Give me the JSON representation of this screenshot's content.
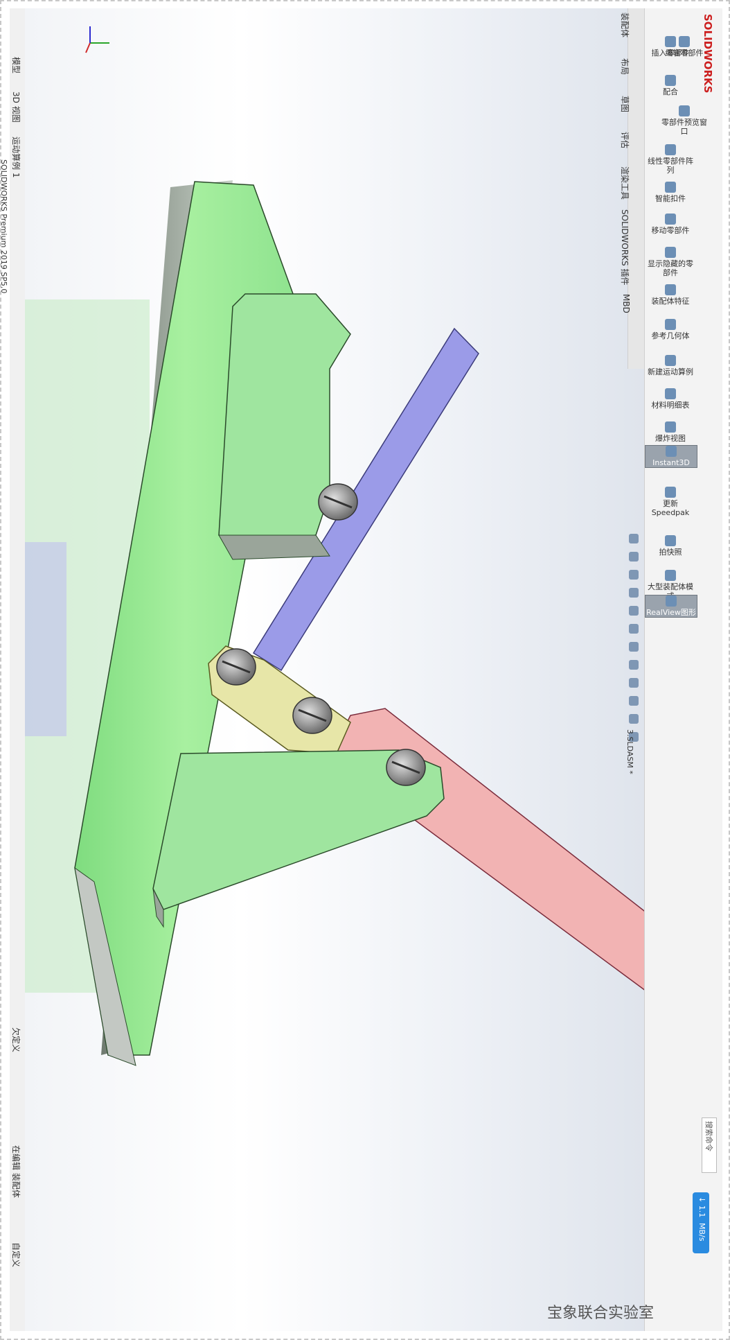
{
  "app": {
    "brand": "SOLIDWORKS",
    "document_title": "3.SLDASM *",
    "status_product": "SOLIDWORKS Premium 2019 SP5.0",
    "search_placeholder": "搜索命令"
  },
  "ribbon": {
    "tools": [
      {
        "label": "编辑零部件",
        "icon": "edit-component-icon"
      },
      {
        "label": "插入零部件",
        "icon": "insert-component-icon"
      },
      {
        "label": "配合",
        "icon": "mate-icon"
      },
      {
        "label": "零部件预览窗口",
        "icon": "component-preview-icon"
      },
      {
        "label": "线性零部件阵列",
        "icon": "linear-pattern-icon"
      },
      {
        "label": "智能扣件",
        "icon": "smart-fastener-icon"
      },
      {
        "label": "移动零部件",
        "icon": "move-component-icon"
      },
      {
        "label": "显示隐藏的零部件",
        "icon": "show-hidden-icon"
      },
      {
        "label": "装配体特征",
        "icon": "assembly-feature-icon"
      },
      {
        "label": "参考几何体",
        "icon": "reference-geometry-icon"
      },
      {
        "label": "新建运动算例",
        "icon": "motion-study-icon"
      },
      {
        "label": "材料明细表",
        "icon": "bom-icon"
      },
      {
        "label": "爆炸视图",
        "icon": "exploded-view-icon"
      },
      {
        "label": "Instant3D",
        "icon": "instant3d-icon",
        "active": true
      },
      {
        "label": "更新Speedpak",
        "icon": "speedpak-icon"
      },
      {
        "label": "拍快照",
        "icon": "snapshot-icon"
      },
      {
        "label": "大型装配体模式",
        "icon": "large-assembly-icon"
      },
      {
        "label": "RealView图形",
        "icon": "realview-icon",
        "active": true
      }
    ],
    "tabs": [
      "装配体",
      "布局",
      "草图",
      "评估",
      "渲染工具",
      "SOLIDWORKS 插件",
      "MBD"
    ]
  },
  "bottom_tabs": [
    "模型",
    "3D 视图",
    "运动算例 1"
  ],
  "status_bar": {
    "undefined": "欠定义",
    "editing": "在编辑 装配体",
    "custom": "自定义"
  },
  "network_speed": {
    "value": "↓ 1.1",
    "unit": "MB/s"
  },
  "watermark": "宝象联合实验室",
  "colors": {
    "base_plate": "#8fe38f",
    "base_plate_dark": "#4f9d4f",
    "link_blue": "#9b9be8",
    "link_red": "#f2b3b3",
    "link_yellow": "#e7e6a8",
    "screw": "#9a9a9a",
    "accent_red": "#cc1f1f"
  }
}
